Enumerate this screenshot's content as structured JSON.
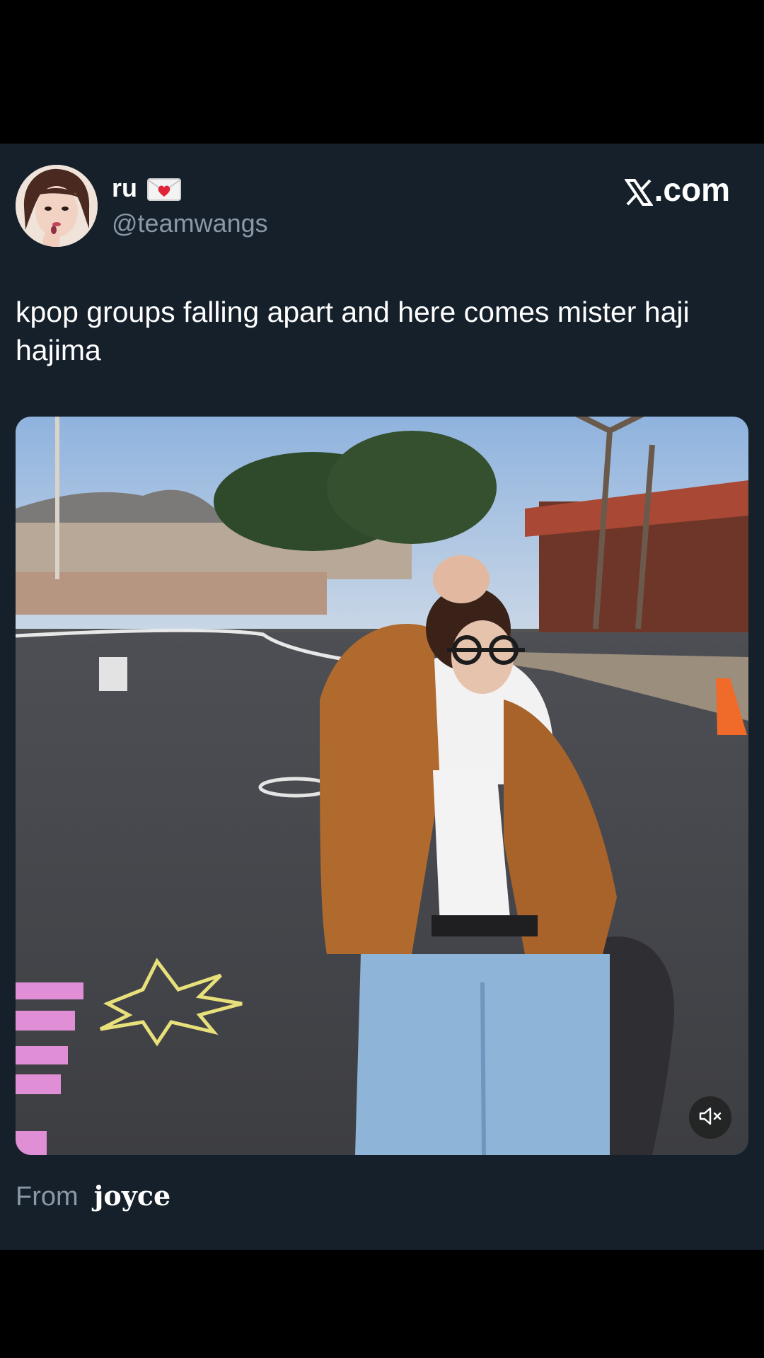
{
  "post": {
    "author": {
      "display_name": "ru",
      "name_emoji": "love-letter-icon",
      "handle": "@teamwangs"
    },
    "brand": {
      "logo": "x-logo-icon",
      "suffix": ".com"
    },
    "text": "kpop groups falling apart and here comes mister haji hajima",
    "media": {
      "type": "video",
      "sound": "muted",
      "mute_icon": "speaker-muted-icon"
    },
    "attribution": {
      "from_label": "From",
      "source": "joyce"
    }
  },
  "colors": {
    "background": "#000000",
    "card": "#15202b",
    "primary_text": "#ffffff",
    "secondary_text": "#8b98a5"
  }
}
